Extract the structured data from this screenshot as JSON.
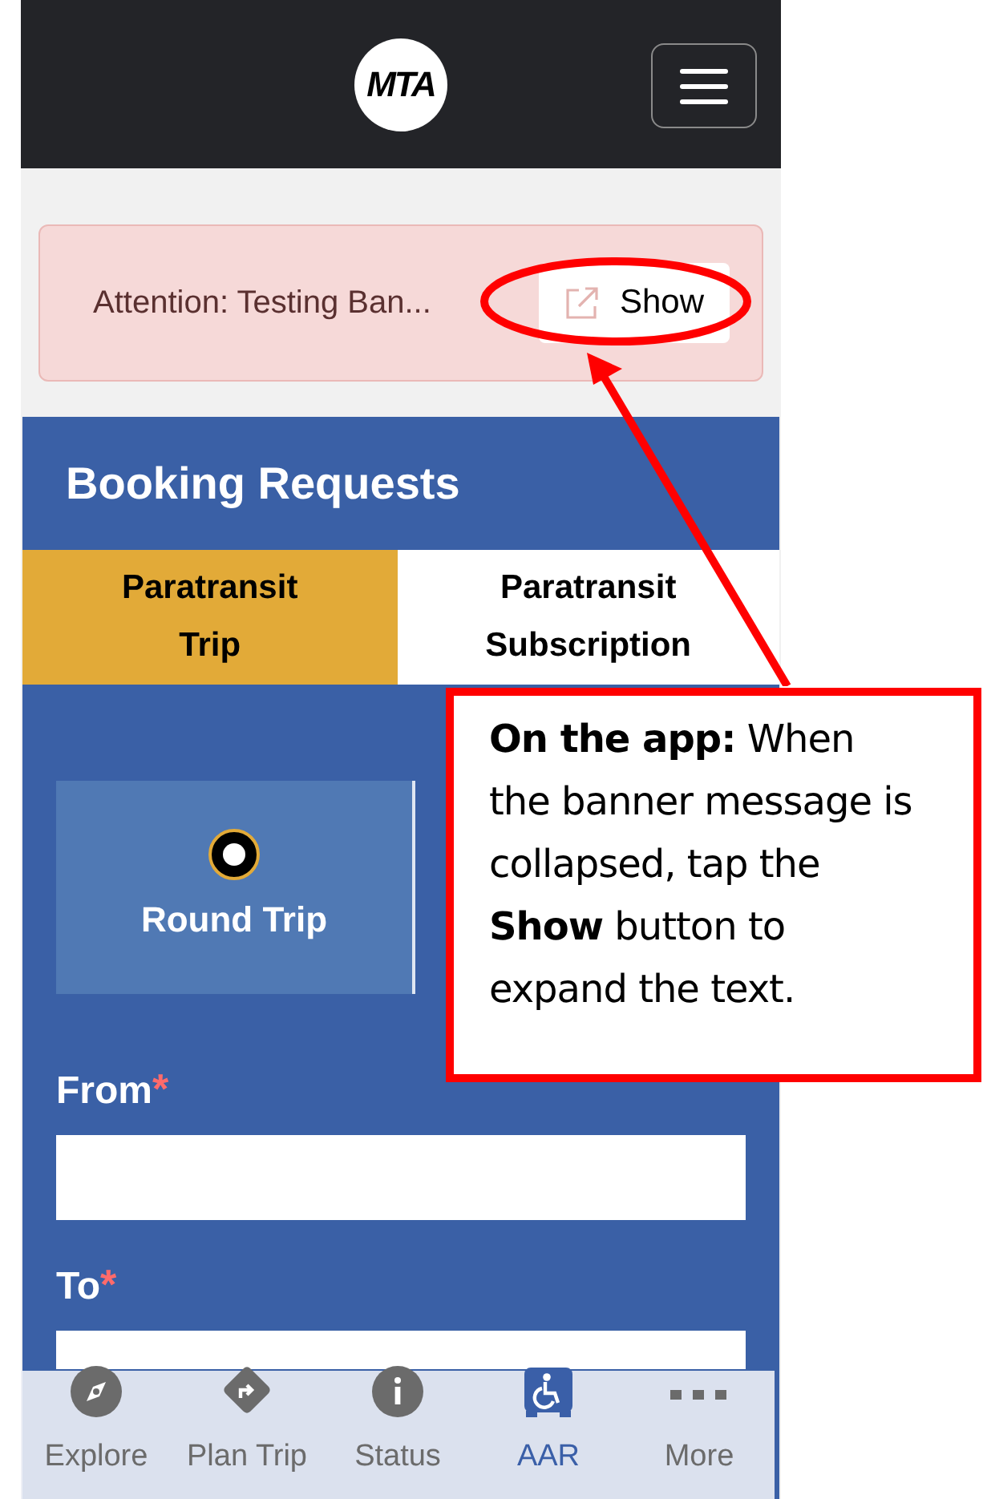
{
  "header": {
    "logo": "MTA"
  },
  "banner": {
    "text": "Attention: Testing Ban...",
    "button": "Show"
  },
  "booking": {
    "title": "Booking Requests",
    "tabs": [
      {
        "label": "Paratransit Trip",
        "selected": true
      },
      {
        "label": "Paratransit Subscription",
        "selected": false
      }
    ],
    "trip_types": [
      {
        "label": "Round Trip",
        "selected": true
      }
    ],
    "fields": [
      {
        "label": "From",
        "marker": "*"
      },
      {
        "label": "To",
        "marker": "*"
      }
    ]
  },
  "nav": [
    {
      "label": "Explore",
      "kind": "explore",
      "selected": false
    },
    {
      "label": "Plan Trip",
      "kind": "plan",
      "selected": false
    },
    {
      "label": "Status",
      "kind": "status",
      "selected": false
    },
    {
      "label": "AAR",
      "kind": "aar",
      "selected": true
    },
    {
      "label": "More",
      "kind": "more",
      "selected": false
    }
  ],
  "annotation": {
    "text": "**On the app:** When the banner message is collapsed, tap the **Show** button to expand the text."
  }
}
